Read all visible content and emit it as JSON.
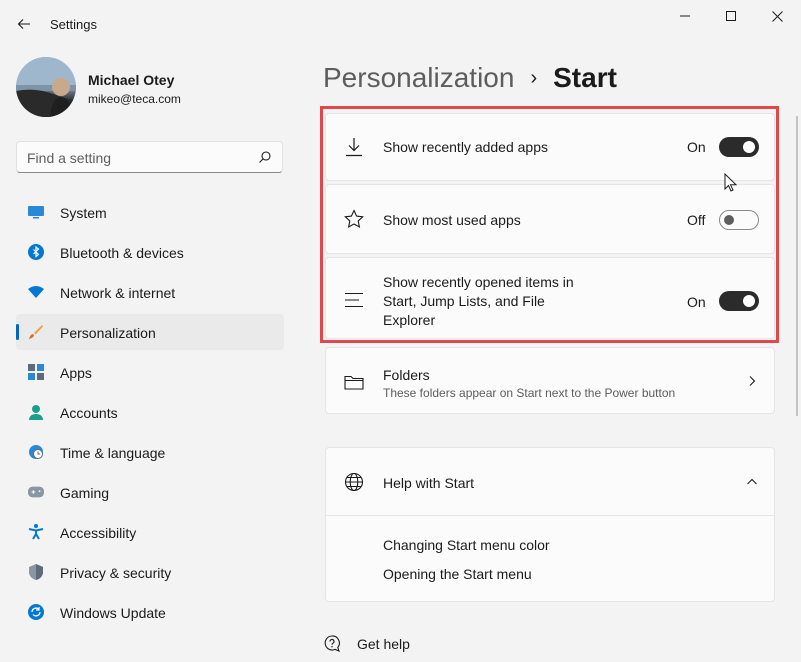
{
  "window": {
    "title": "Settings"
  },
  "user": {
    "name": "Michael Otey",
    "email": "mikeo@teca.com"
  },
  "search": {
    "placeholder": "Find a setting"
  },
  "nav": {
    "items": [
      {
        "label": "System",
        "icon": "monitor-icon"
      },
      {
        "label": "Bluetooth & devices",
        "icon": "bluetooth-icon"
      },
      {
        "label": "Network & internet",
        "icon": "wifi-icon"
      },
      {
        "label": "Personalization",
        "icon": "brush-icon",
        "selected": true
      },
      {
        "label": "Apps",
        "icon": "apps-icon"
      },
      {
        "label": "Accounts",
        "icon": "person-icon"
      },
      {
        "label": "Time & language",
        "icon": "globe-clock-icon"
      },
      {
        "label": "Gaming",
        "icon": "gamepad-icon"
      },
      {
        "label": "Accessibility",
        "icon": "accessibility-icon"
      },
      {
        "label": "Privacy & security",
        "icon": "shield-icon"
      },
      {
        "label": "Windows Update",
        "icon": "refresh-icon"
      }
    ]
  },
  "breadcrumb": {
    "parent": "Personalization",
    "separator": "›",
    "current": "Start"
  },
  "settings": [
    {
      "label": "Show recently added apps",
      "state": "On",
      "on": true,
      "icon": "download-icon"
    },
    {
      "label": "Show most used apps",
      "state": "Off",
      "on": false,
      "icon": "star-icon"
    },
    {
      "label_lines": [
        "Show recently opened items in",
        "Start, Jump Lists, and File",
        "Explorer"
      ],
      "state": "On",
      "on": true,
      "icon": "list-icon"
    }
  ],
  "folders": {
    "title": "Folders",
    "description": "These folders appear on Start next to the Power button"
  },
  "help": {
    "title": "Help with Start",
    "links": [
      "Changing Start menu color",
      "Opening the Start menu"
    ]
  },
  "get_help": {
    "label": "Get help"
  },
  "colors": {
    "accent": "#0067c0",
    "highlight": "#e0484d",
    "toggle_on": "#2b2b2b"
  }
}
